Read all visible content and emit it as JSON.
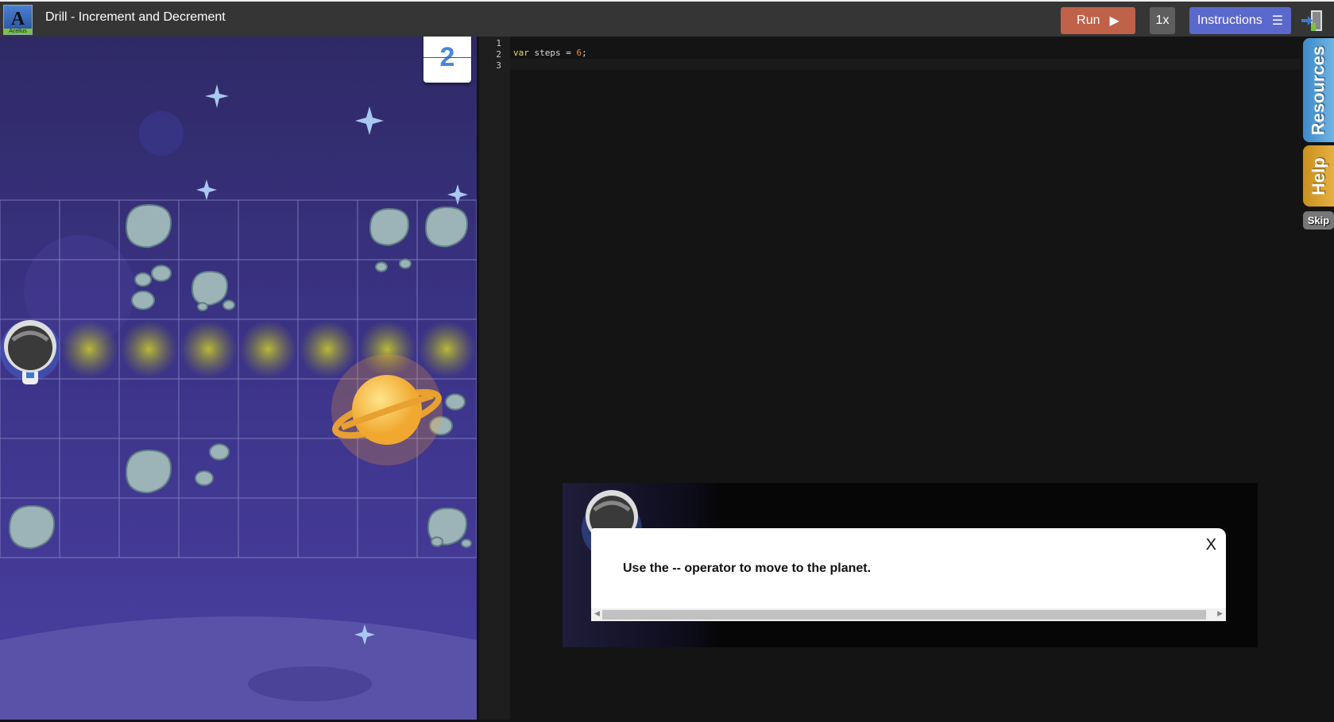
{
  "header": {
    "title": "Drill - Increment and Decrement",
    "logo_text": "Acellus",
    "run_label": "Run",
    "run_icon": "play-icon",
    "speed_label": "1x",
    "instructions_label": "Instructions",
    "instructions_icon": "menu-icon",
    "exit_icon": "exit-door-icon"
  },
  "game": {
    "step_counter": "2",
    "grid": {
      "cols": 8,
      "rows": 6
    },
    "astronaut_cell": [
      0,
      2
    ],
    "path_cells": [
      [
        1,
        2
      ],
      [
        2,
        2
      ],
      [
        3,
        2
      ],
      [
        4,
        2
      ],
      [
        5,
        2
      ],
      [
        6,
        2
      ],
      [
        7,
        2
      ]
    ],
    "planet_cell": [
      6,
      3
    ]
  },
  "editor": {
    "line_numbers": [
      "1",
      "2",
      "3"
    ],
    "code": {
      "kw": "var",
      "name": " steps = ",
      "num": "6",
      "end": ";"
    }
  },
  "popup": {
    "message": "Use the -- operator to move to the planet.",
    "close_label": "X"
  },
  "side_tabs": {
    "resources": "Resources",
    "help": "Help",
    "skip": "Skip"
  },
  "colors": {
    "run": "#c0614a",
    "instructions": "#5b68cc",
    "resources": "#4a9ad6",
    "help": "#d9a030",
    "space": "#3b3478"
  }
}
